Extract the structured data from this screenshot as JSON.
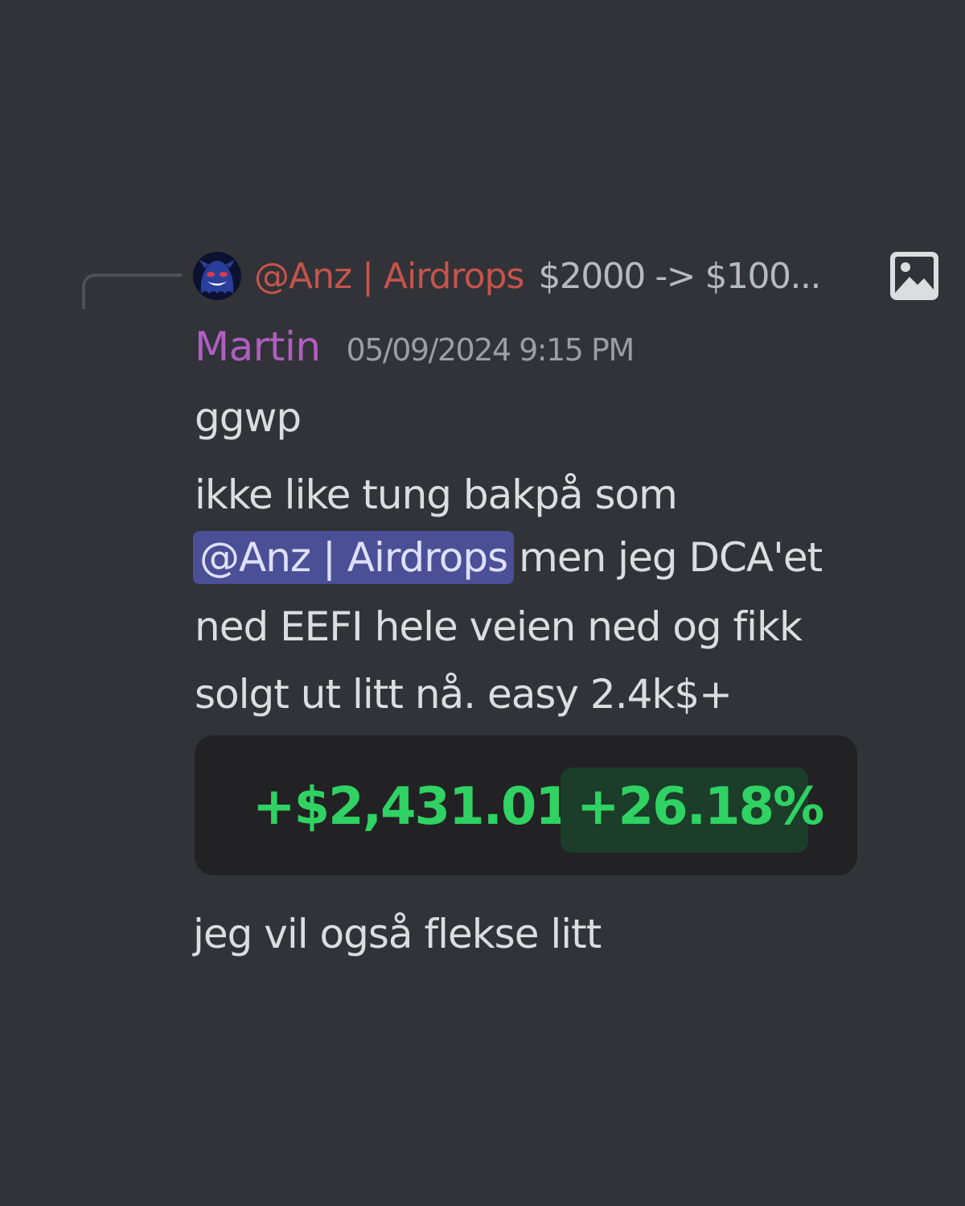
{
  "reply": {
    "author": "@Anz | Airdrops",
    "snippet": "$2000 -> $100...",
    "avatar_icon": "ghost-avatar-icon",
    "attachment_icon": "image-icon"
  },
  "message": {
    "username": "Martin",
    "timestamp": "05/09/2024 9:15 PM",
    "line1": "ggwp",
    "line2": "ikke like tung bakpå som",
    "mention": "@Anz | Airdrops",
    "line3_rest": "men jeg DCA'et",
    "line4": "ned EEFI hele veien ned og fikk",
    "line5": "solgt ut litt nå. easy 2.4k$+",
    "after_embed": "jeg vil også flekse litt"
  },
  "pnl_card": {
    "amount": "+$2,431.01",
    "percent": "+26.18%"
  },
  "colors": {
    "background": "#313338",
    "reply_author": "#c5544b",
    "username": "#b05ec0",
    "mention_bg": "#4a4f96",
    "profit_green": "#2fd263"
  }
}
